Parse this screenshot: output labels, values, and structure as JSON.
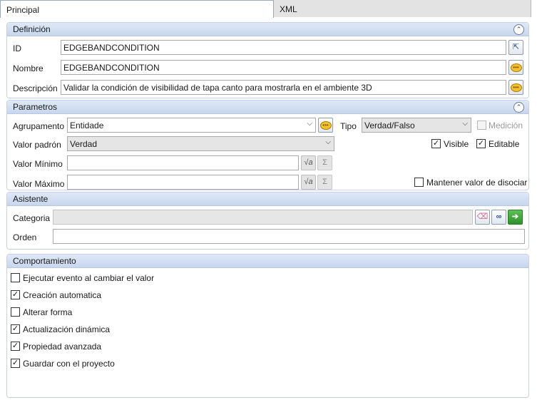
{
  "tabs": [
    {
      "label": "Principal"
    },
    {
      "label": "XML"
    }
  ],
  "definicion": {
    "title": "Definición",
    "id_label": "ID",
    "id_value": "EDGEBANDCONDITION",
    "nombre_label": "Nombre",
    "nombre_value": "EDGEBANDCONDITION",
    "descripcion_label": "Descripción",
    "descripcion_value": "Validar la condición de visibilidad de tapa canto para mostrarla en el ambiente 3D"
  },
  "parametros": {
    "title": "Parametros",
    "agrupamento_label": "Agrupamento",
    "agrupamento_value": "Entidade",
    "tipo_label": "Tipo",
    "tipo_value": "Verdad/Falso",
    "medicion_label": "Medición",
    "medicion_checked": false,
    "valor_padron_label": "Valor padrón",
    "valor_padron_value": "Verdad",
    "visible_label": "Visible",
    "visible_checked": true,
    "editable_label": "Editable",
    "editable_checked": true,
    "valor_minimo_label": "Valor Mínimo",
    "valor_minimo_value": "",
    "valor_maximo_label": "Valor Máximo",
    "valor_maximo_value": "",
    "mantener_label": "Mantener valor de disociar",
    "mantener_checked": false,
    "sigma_symbol": "Σ"
  },
  "asistente": {
    "title": "Asistente",
    "categoria_label": "Categoria",
    "categoria_value": "",
    "orden_label": "Orden",
    "orden_value": ""
  },
  "comportamiento": {
    "title": "Comportamiento",
    "items": [
      {
        "label": "Ejecutar evento al cambiar el valor",
        "checked": false
      },
      {
        "label": "Creación automatica",
        "checked": true
      },
      {
        "label": "Alterar forma",
        "checked": false
      },
      {
        "label": "Actualización dinámica",
        "checked": true
      },
      {
        "label": "Propiedad avanzada",
        "checked": true
      },
      {
        "label": "Guardar con el proyecto",
        "checked": true
      }
    ]
  },
  "colors": {
    "panel_header": "#c8d7ee",
    "panel_border": "#c6d3e6",
    "tooltip_icon": "#f2c12e",
    "go_button": "#2f8f2b"
  }
}
